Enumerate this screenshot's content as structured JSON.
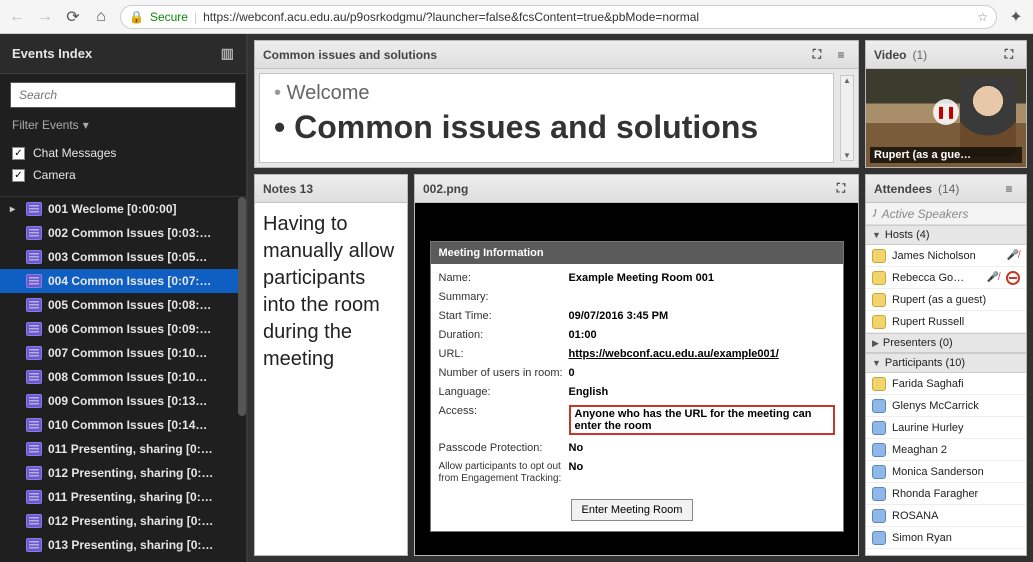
{
  "chrome": {
    "secure_label": "Secure",
    "url": "https://webconf.acu.edu.au/p9osrkodgmu/?launcher=false&fcsContent=true&pbMode=normal"
  },
  "sidebar": {
    "title": "Events Index",
    "search_placeholder": "Search",
    "filter_label": "Filter Events",
    "checkboxes": [
      {
        "label": "Chat Messages",
        "checked": true
      },
      {
        "label": "Camera",
        "checked": true
      }
    ],
    "events": [
      {
        "label": "001 Weclome [0:00:00]",
        "selected": false,
        "expandable": true
      },
      {
        "label": "002 Common Issues [0:03:…",
        "selected": false
      },
      {
        "label": "003 Common Issues [0:05…",
        "selected": false
      },
      {
        "label": "004 Common Issues [0:07:…",
        "selected": true
      },
      {
        "label": "005 Common Issues [0:08:…",
        "selected": false
      },
      {
        "label": "006 Common Issues [0:09:…",
        "selected": false
      },
      {
        "label": "007 Common Issues [0:10…",
        "selected": false
      },
      {
        "label": "008 Common Issues [0:10…",
        "selected": false
      },
      {
        "label": "009 Common Issues [0:13…",
        "selected": false
      },
      {
        "label": "010 Common Issues [0:14…",
        "selected": false
      },
      {
        "label": "011 Presenting, sharing [0:…",
        "selected": false
      },
      {
        "label": "012 Presenting, sharing [0:…",
        "selected": false
      },
      {
        "label": "011 Presenting, sharing [0:…",
        "selected": false
      },
      {
        "label": "012 Presenting, sharing [0:…",
        "selected": false
      },
      {
        "label": "013 Presenting, sharing [0:…",
        "selected": false
      }
    ]
  },
  "slide": {
    "title": "Common issues and solutions",
    "bullet1": "Welcome",
    "bullet2": "Common issues and solutions"
  },
  "notes": {
    "title": "Notes 13",
    "body": "Having to manually allow participants into the room during the meeting"
  },
  "image": {
    "title": "002.png",
    "meeting": {
      "header": "Meeting Information",
      "rows": [
        {
          "label": "Name:",
          "value": "Example Meeting Room 001"
        },
        {
          "label": "Summary:",
          "value": ""
        },
        {
          "label": "Start Time:",
          "value": "09/07/2016 3:45 PM"
        },
        {
          "label": "Duration:",
          "value": "01:00"
        },
        {
          "label": "URL:",
          "value": "https://webconf.acu.edu.au/example001/",
          "link": true
        },
        {
          "label": "Number of users in room:",
          "value": "0"
        },
        {
          "label": "Language:",
          "value": "English"
        },
        {
          "label": "Access:",
          "value": "Anyone who has the URL for the meeting can enter the room",
          "highlight": true
        },
        {
          "label": "Passcode Protection:",
          "value": "No"
        },
        {
          "label": "Allow participants to opt out from Engagement Tracking:",
          "value": "No",
          "small": true
        }
      ],
      "enter_button": "Enter Meeting Room"
    }
  },
  "video": {
    "title": "Video",
    "count": "(1)",
    "caption": "Rupert (as a gue…"
  },
  "attendees": {
    "title": "Attendees",
    "count": "(14)",
    "active_label": "Active Speakers",
    "groups": [
      {
        "name": "Hosts (4)",
        "expanded": true,
        "members": [
          {
            "name": "James Nicholson",
            "avatar": "yellow",
            "mic_off": true
          },
          {
            "name": "Rebecca Go…",
            "avatar": "yellow",
            "mic_off": true,
            "deny": true
          },
          {
            "name": "Rupert (as a guest)",
            "avatar": "yellow"
          },
          {
            "name": "Rupert Russell",
            "avatar": "yellow"
          }
        ]
      },
      {
        "name": "Presenters (0)",
        "expanded": false,
        "members": []
      },
      {
        "name": "Participants (10)",
        "expanded": true,
        "members": [
          {
            "name": "Farida Saghafi",
            "avatar": "yellow"
          },
          {
            "name": "Glenys McCarrick",
            "avatar": "blue"
          },
          {
            "name": "Laurine Hurley",
            "avatar": "blue"
          },
          {
            "name": "Meaghan 2",
            "avatar": "blue"
          },
          {
            "name": "Monica Sanderson",
            "avatar": "blue"
          },
          {
            "name": "Rhonda Faragher",
            "avatar": "blue"
          },
          {
            "name": "ROSANA",
            "avatar": "blue"
          },
          {
            "name": "Simon Ryan",
            "avatar": "blue"
          }
        ]
      }
    ]
  }
}
